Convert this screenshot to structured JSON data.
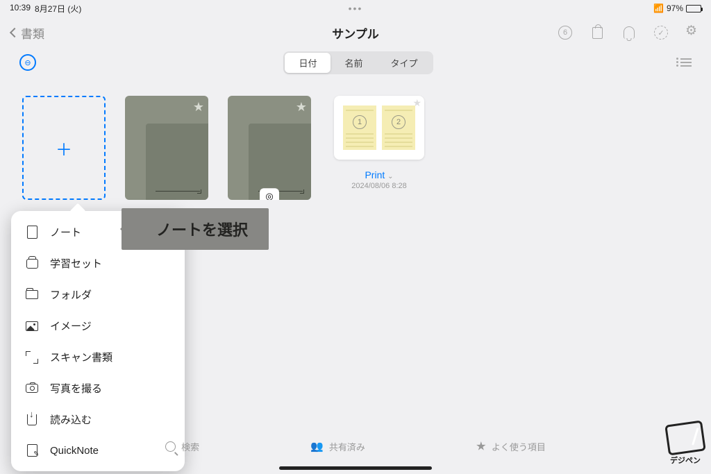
{
  "status": {
    "time": "10:39",
    "date": "8月27日 (火)",
    "battery_pct": "97%"
  },
  "nav": {
    "back_label": "書類",
    "title": "サンプル",
    "badge": "6"
  },
  "segment": {
    "items": [
      "日付",
      "名前",
      "タイプ"
    ],
    "active_index": 0
  },
  "tiles": {
    "print": {
      "label": "Print",
      "date": "2024/08/06 8:28"
    }
  },
  "popup": {
    "items": [
      {
        "label": "ノート"
      },
      {
        "label": "学習セット"
      },
      {
        "label": "フォルダ"
      },
      {
        "label": "イメージ"
      },
      {
        "label": "スキャン書類"
      },
      {
        "label": "写真を撮る"
      },
      {
        "label": "読み込む"
      },
      {
        "label": "QuickNote"
      }
    ]
  },
  "annotation": "ノートを選択",
  "bottom": {
    "search": "検索",
    "shared": "共有済み",
    "fav": "よく使う項目"
  },
  "logo": "デジペン"
}
